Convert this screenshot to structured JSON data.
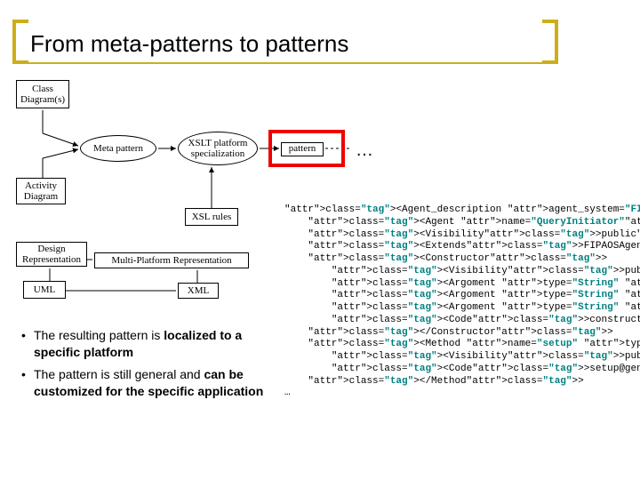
{
  "title": "From meta-patterns to patterns",
  "nodes": {
    "class_diagrams": "Class Diagram(s)",
    "meta_pattern": "Meta pattern",
    "xslt_platform": "XSLT platform specialization",
    "pattern": "pattern",
    "dots": "…",
    "activity_diagram": "Activity Diagram",
    "xsl_rules": "XSL rules",
    "design_rep": "Design Representation",
    "multi_platform": "Multi-Platform Representation",
    "uml": "UML",
    "xml": "XML"
  },
  "bullets": [
    {
      "pre": "The resulting pattern is ",
      "bold": "localized to a specific platform",
      "post": ""
    },
    {
      "pre": "The pattern is still general and ",
      "bold": "can be customized for the specific application",
      "post": ""
    }
  ],
  "code_lines": [
    "<Agent_description agent_system=\"FIPAOS\">",
    "    <Agent name=\"QueryInitiator\">",
    "    <Visibility>public</Visibility>",
    "    <Extends>FIPAOSAgent</Extends>",
    "    <Constructor>",
    "        <Visibility>public</Visibility>",
    "        <Argoment type=\"String\" name=\"platform\"/>",
    "        <Argoment type=\"String\" name=\"name\"/>",
    "        <Argoment type=\"String\" name=\"ownership\"/>",
    "        <Code>constructor@generic_agent</Code>",
    "    </Constructor>",
    "    <Method name=\"setup\" type=\"void\">",
    "        <Visibility>public</Visibility>",
    "        <Code>setup@generic_agent</Code>",
    "    </Method>",
    "…"
  ]
}
